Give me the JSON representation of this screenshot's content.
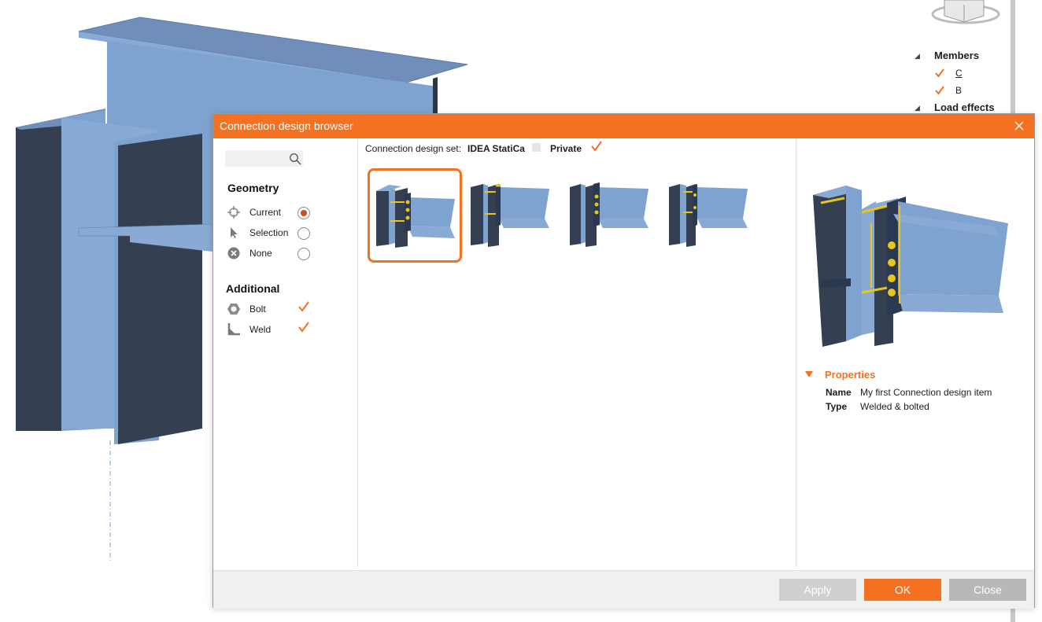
{
  "tree": {
    "members_label": "Members",
    "member_c": "C",
    "member_b": "B",
    "load_effects_label": "Load effects"
  },
  "dialog": {
    "title": "Connection design browser",
    "search": {
      "value": "",
      "placeholder": ""
    },
    "geometry": {
      "title": "Geometry",
      "options": [
        "Current",
        "Selection",
        "None"
      ],
      "selected": "Current"
    },
    "additional": {
      "title": "Additional",
      "options": [
        "Bolt",
        "Weld"
      ]
    },
    "set": {
      "label": "Connection design set:",
      "idea_label": "IDEA StatiCa",
      "private_label": "Private"
    },
    "properties": {
      "title": "Properties",
      "name_key": "Name",
      "name_value": "My first Connection design item",
      "type_key": "Type",
      "type_value": "Welded & bolted"
    },
    "buttons": {
      "apply": "Apply",
      "ok": "OK",
      "close": "Close"
    }
  },
  "colors": {
    "accent": "#f37121",
    "steel_light": "#7fa3d0",
    "steel_dark": "#343f52",
    "weld": "#e8c51a"
  },
  "icons": [
    "search-icon",
    "crosshair-icon",
    "cursor-icon",
    "none-icon",
    "bolt-icon",
    "weld-icon",
    "close-icon",
    "check-icon",
    "triangle-down-icon"
  ]
}
